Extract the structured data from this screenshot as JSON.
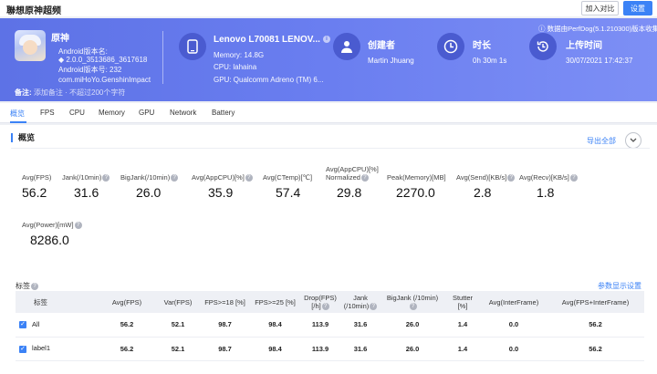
{
  "header": {
    "title": "聯想原神超频",
    "compare_btn": "加入对比",
    "settings_btn": "设置"
  },
  "app": {
    "name": "原神",
    "android_name_label": "Android版本名:",
    "android_name_value": "◆ 2.0.0_3513686_3617618",
    "android_code": "Android版本号: 232",
    "package": "com.miHoYo.GenshinImpact"
  },
  "device": {
    "title": "Lenovo L70081 LENOV...",
    "memory": "Memory: 14.8G",
    "cpu": "CPU: lahaina",
    "gpu": "GPU: Qualcomm Adreno (TM) 6..."
  },
  "creator": {
    "label": "创建者",
    "value": "Martin Jhuang"
  },
  "duration": {
    "label": "时长",
    "value": "0h 30m 1s"
  },
  "upload": {
    "label": "上传时间",
    "value": "30/07/2021 17:42:37",
    "note": "数据由PerfDog(5.1.210300)版本收集"
  },
  "remark": {
    "label": "备注:",
    "placeholder": "添加备注 · 不超过200个字符"
  },
  "tabs": [
    "概览",
    "FPS",
    "CPU",
    "Memory",
    "GPU",
    "Network",
    "Battery"
  ],
  "overview": {
    "title": "概览",
    "export": "导出全部"
  },
  "metrics": [
    {
      "label": "Avg(FPS)",
      "value": "56.2"
    },
    {
      "label": "Jank(/10min)",
      "value": "31.6"
    },
    {
      "label": "BigJank(/10min)",
      "value": "26.0"
    },
    {
      "label": "Avg(AppCPU)[%]",
      "value": "35.9"
    },
    {
      "label": "Avg(CTemp)[℃]",
      "value": "57.4"
    },
    {
      "label": "Avg(AppCPU)[%]",
      "label2": "Normalized",
      "value": "29.8"
    },
    {
      "label": "Peak(Memory)[MB]",
      "value": "2270.0"
    },
    {
      "label": "Avg(Send)[KB/s]",
      "value": "2.8"
    },
    {
      "label": "Avg(Recv)[KB/s]",
      "value": "1.8"
    },
    {
      "label": "Avg(Power)[mW]",
      "value": "8286.0"
    }
  ],
  "tags": {
    "label": "标签",
    "param_link": "参数显示设置"
  },
  "table": {
    "headers": [
      "标签",
      "Avg(FPS)",
      "Var(FPS)",
      "FPS>=18 [%]",
      "FPS>=25 [%]",
      "Drop(FPS) [/h]",
      "Jank (/10min)",
      "BigJank (/10min)",
      "Stutter [%]",
      "Avg(InterFrame)",
      "Avg(FPS+InterFrame)"
    ],
    "rows": [
      [
        "All",
        "56.2",
        "52.1",
        "98.7",
        "98.4",
        "113.9",
        "31.6",
        "26.0",
        "1.4",
        "0.0",
        "56.2"
      ],
      [
        "label1",
        "56.2",
        "52.1",
        "98.7",
        "98.4",
        "113.9",
        "31.6",
        "26.0",
        "1.4",
        "0.0",
        "56.2"
      ]
    ]
  }
}
